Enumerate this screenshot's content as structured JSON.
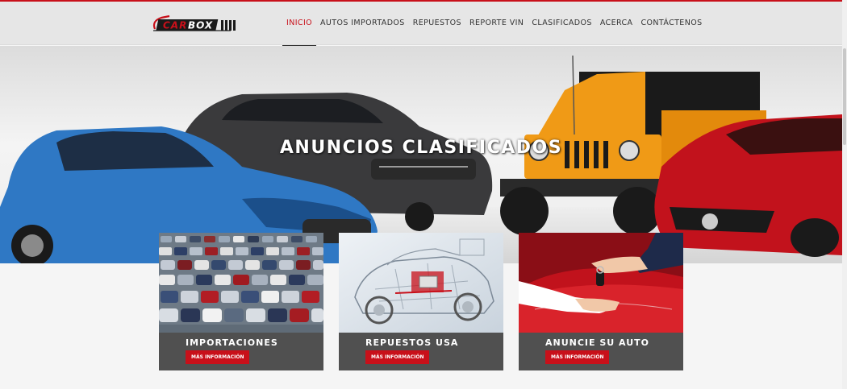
{
  "brand": {
    "logo_text": "CARBOX",
    "accent_color": "#c8101a"
  },
  "nav": {
    "items": [
      {
        "label": "INICIO",
        "active": true
      },
      {
        "label": "AUTOS IMPORTADOS",
        "active": false
      },
      {
        "label": "REPUESTOS",
        "active": false
      },
      {
        "label": "REPORTE VIN",
        "active": false
      },
      {
        "label": "CLASIFICADOS",
        "active": false
      },
      {
        "label": "ACERCA",
        "active": false
      },
      {
        "label": "CONTÁCTENOS",
        "active": false
      }
    ]
  },
  "hero": {
    "title": "ANUNCIOS CLASIFICADOS",
    "car_colors": [
      "#2f78c4",
      "#3a3a3c",
      "#f09a16",
      "#c2121c"
    ]
  },
  "cards": [
    {
      "title": "IMPORTACIONES",
      "button": "MÁS INFORMACIÓN",
      "image": "car-lot-photo"
    },
    {
      "title": "REPUESTOS USA",
      "button": "MÁS INFORMACIÓN",
      "image": "car-parts-xray-photo"
    },
    {
      "title": "ANUNCIE SU AUTO",
      "button": "MÁS INFORMACIÓN",
      "image": "car-key-handover-photo"
    }
  ]
}
